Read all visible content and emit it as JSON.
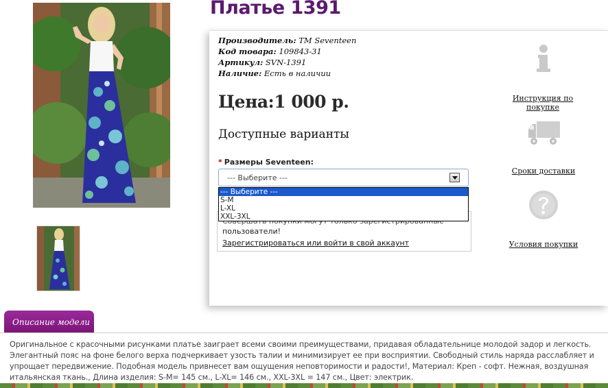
{
  "product": {
    "title": "Платье 1391",
    "specs": [
      {
        "label": "Производитель:",
        "value": "TM Seventeen"
      },
      {
        "label": "Код товара:",
        "value": "109843-31"
      },
      {
        "label": "Артикул:",
        "value": "SVN-1391"
      },
      {
        "label": "Наличие:",
        "value": "Есть в наличии"
      }
    ],
    "price": "Цена:1 000 р.",
    "variants_heading": "Доступные варианты",
    "size_label": "Размеры Seventeen:",
    "size_required_mark": "*",
    "select": {
      "selected": "--- Выберите ---",
      "options": [
        "--- Выберите ---",
        "S-M",
        "L-XL",
        "XXL-3XL"
      ]
    },
    "notice": {
      "line1": "Совершать покупки могут только зарегистрированные",
      "line2": "пользователи!",
      "login_link": "Зарегистрироваться или войти в свой аккаунт"
    }
  },
  "sidebar": {
    "items": [
      {
        "label": "Инструкция по покупке",
        "icon": "info-icon"
      },
      {
        "label": "Сроки доставки",
        "icon": "truck-icon"
      },
      {
        "label": "Условия покупки",
        "icon": "question-icon"
      }
    ]
  },
  "description": {
    "tab_label": "Описание модели",
    "text": "Оригинальное с красочными рисунками платье заиграет всеми своими преимуществами, придавая обладательнице молодой задор и легкость. Элегантный пояс на фоне белого верха подчеркивает узость талии и минимизирует ее при восприятии. Свободный стиль наряда расслабляет и упрощает передвижение. Подобная модель привнесет вам ощущения неповторимости и радости!, Материал: Креп - софт. Нежная, воздушная итальянская ткань., Длина изделия: S-M= 145 см., L-XL= 146 см., XXL-3XL = 147 см., Цвет: электрик."
  },
  "colors": {
    "title": "#5b1a6e",
    "tab": "#8a1f88",
    "dress_blue": "#2b2f9e",
    "dropdown_highlight": "#1b59cc"
  }
}
